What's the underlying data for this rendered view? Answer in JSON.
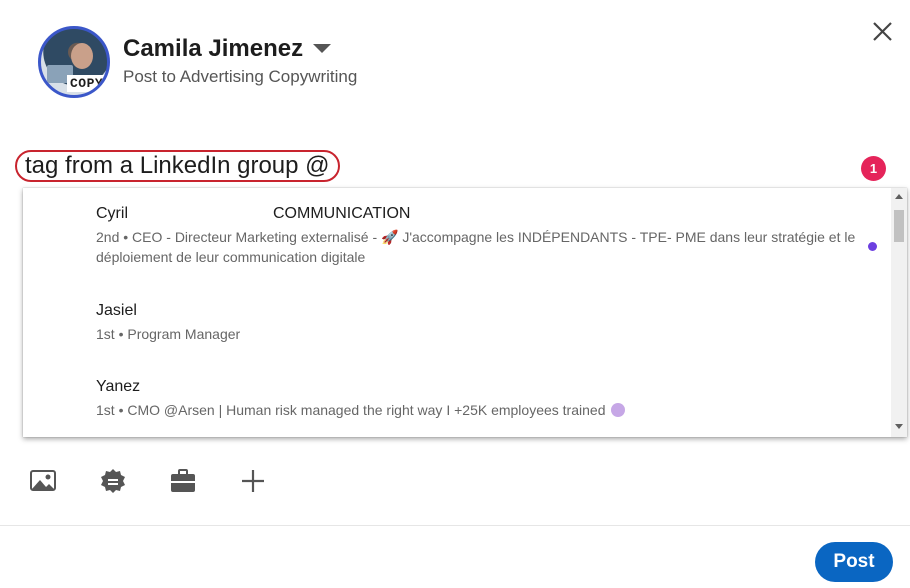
{
  "header": {
    "avatar_text": "COPY",
    "author_name": "Camila Jimenez",
    "post_target": "Post to Advertising Copywriting"
  },
  "editor": {
    "text": "tag from a LinkedIn group @",
    "notification_count": "1"
  },
  "mentions": [
    {
      "name": "Cyril",
      "company": "COMMUNICATION",
      "description": "2nd • CEO - Directeur Marketing externalisé - 🚀 J'accompagne les INDÉPENDANTS - TPE- PME dans leur stratégie et le déploiement de leur communication digitale"
    },
    {
      "name": "Jasiel",
      "description": "1st • Program Manager"
    },
    {
      "name": "Yanez",
      "description": "1st • CMO @Arsen | Human risk managed the right way I +25K employees trained"
    }
  ],
  "toolbar": {
    "icons": [
      "image-icon",
      "badge-icon",
      "briefcase-icon",
      "plus-icon"
    ]
  },
  "footer": {
    "post_label": "Post"
  },
  "colors": {
    "accent": "#0a66c2",
    "badge": "#e5245a",
    "highlight_outline": "#c8242e"
  }
}
